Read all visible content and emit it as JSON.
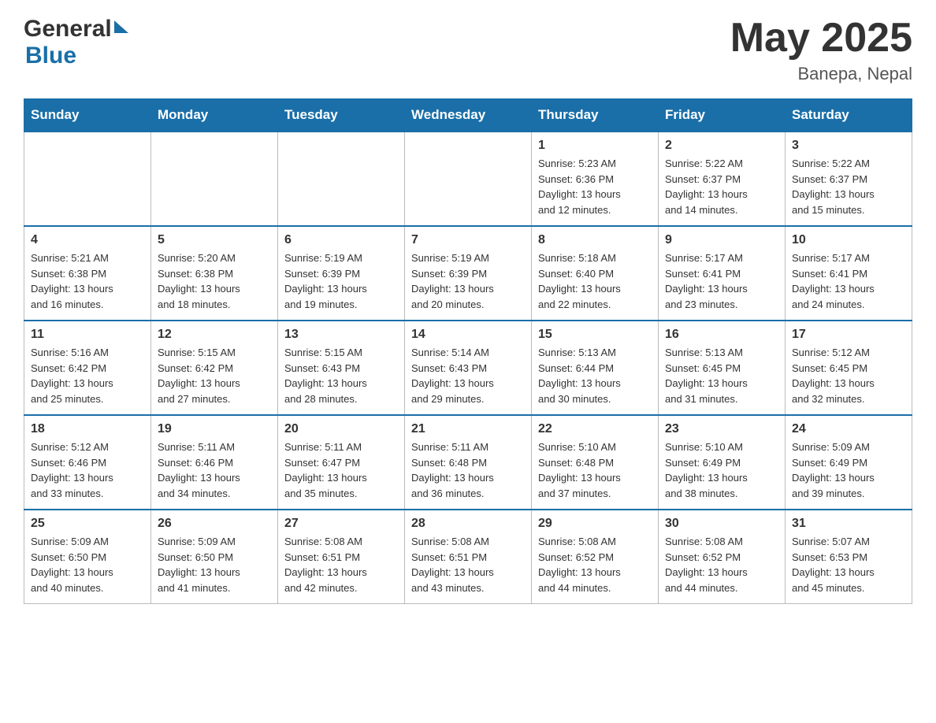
{
  "header": {
    "title": "May 2025",
    "location": "Banepa, Nepal"
  },
  "days_of_week": [
    "Sunday",
    "Monday",
    "Tuesday",
    "Wednesday",
    "Thursday",
    "Friday",
    "Saturday"
  ],
  "weeks": [
    [
      {
        "day": "",
        "info": ""
      },
      {
        "day": "",
        "info": ""
      },
      {
        "day": "",
        "info": ""
      },
      {
        "day": "",
        "info": ""
      },
      {
        "day": "1",
        "info": "Sunrise: 5:23 AM\nSunset: 6:36 PM\nDaylight: 13 hours\nand 12 minutes."
      },
      {
        "day": "2",
        "info": "Sunrise: 5:22 AM\nSunset: 6:37 PM\nDaylight: 13 hours\nand 14 minutes."
      },
      {
        "day": "3",
        "info": "Sunrise: 5:22 AM\nSunset: 6:37 PM\nDaylight: 13 hours\nand 15 minutes."
      }
    ],
    [
      {
        "day": "4",
        "info": "Sunrise: 5:21 AM\nSunset: 6:38 PM\nDaylight: 13 hours\nand 16 minutes."
      },
      {
        "day": "5",
        "info": "Sunrise: 5:20 AM\nSunset: 6:38 PM\nDaylight: 13 hours\nand 18 minutes."
      },
      {
        "day": "6",
        "info": "Sunrise: 5:19 AM\nSunset: 6:39 PM\nDaylight: 13 hours\nand 19 minutes."
      },
      {
        "day": "7",
        "info": "Sunrise: 5:19 AM\nSunset: 6:39 PM\nDaylight: 13 hours\nand 20 minutes."
      },
      {
        "day": "8",
        "info": "Sunrise: 5:18 AM\nSunset: 6:40 PM\nDaylight: 13 hours\nand 22 minutes."
      },
      {
        "day": "9",
        "info": "Sunrise: 5:17 AM\nSunset: 6:41 PM\nDaylight: 13 hours\nand 23 minutes."
      },
      {
        "day": "10",
        "info": "Sunrise: 5:17 AM\nSunset: 6:41 PM\nDaylight: 13 hours\nand 24 minutes."
      }
    ],
    [
      {
        "day": "11",
        "info": "Sunrise: 5:16 AM\nSunset: 6:42 PM\nDaylight: 13 hours\nand 25 minutes."
      },
      {
        "day": "12",
        "info": "Sunrise: 5:15 AM\nSunset: 6:42 PM\nDaylight: 13 hours\nand 27 minutes."
      },
      {
        "day": "13",
        "info": "Sunrise: 5:15 AM\nSunset: 6:43 PM\nDaylight: 13 hours\nand 28 minutes."
      },
      {
        "day": "14",
        "info": "Sunrise: 5:14 AM\nSunset: 6:43 PM\nDaylight: 13 hours\nand 29 minutes."
      },
      {
        "day": "15",
        "info": "Sunrise: 5:13 AM\nSunset: 6:44 PM\nDaylight: 13 hours\nand 30 minutes."
      },
      {
        "day": "16",
        "info": "Sunrise: 5:13 AM\nSunset: 6:45 PM\nDaylight: 13 hours\nand 31 minutes."
      },
      {
        "day": "17",
        "info": "Sunrise: 5:12 AM\nSunset: 6:45 PM\nDaylight: 13 hours\nand 32 minutes."
      }
    ],
    [
      {
        "day": "18",
        "info": "Sunrise: 5:12 AM\nSunset: 6:46 PM\nDaylight: 13 hours\nand 33 minutes."
      },
      {
        "day": "19",
        "info": "Sunrise: 5:11 AM\nSunset: 6:46 PM\nDaylight: 13 hours\nand 34 minutes."
      },
      {
        "day": "20",
        "info": "Sunrise: 5:11 AM\nSunset: 6:47 PM\nDaylight: 13 hours\nand 35 minutes."
      },
      {
        "day": "21",
        "info": "Sunrise: 5:11 AM\nSunset: 6:48 PM\nDaylight: 13 hours\nand 36 minutes."
      },
      {
        "day": "22",
        "info": "Sunrise: 5:10 AM\nSunset: 6:48 PM\nDaylight: 13 hours\nand 37 minutes."
      },
      {
        "day": "23",
        "info": "Sunrise: 5:10 AM\nSunset: 6:49 PM\nDaylight: 13 hours\nand 38 minutes."
      },
      {
        "day": "24",
        "info": "Sunrise: 5:09 AM\nSunset: 6:49 PM\nDaylight: 13 hours\nand 39 minutes."
      }
    ],
    [
      {
        "day": "25",
        "info": "Sunrise: 5:09 AM\nSunset: 6:50 PM\nDaylight: 13 hours\nand 40 minutes."
      },
      {
        "day": "26",
        "info": "Sunrise: 5:09 AM\nSunset: 6:50 PM\nDaylight: 13 hours\nand 41 minutes."
      },
      {
        "day": "27",
        "info": "Sunrise: 5:08 AM\nSunset: 6:51 PM\nDaylight: 13 hours\nand 42 minutes."
      },
      {
        "day": "28",
        "info": "Sunrise: 5:08 AM\nSunset: 6:51 PM\nDaylight: 13 hours\nand 43 minutes."
      },
      {
        "day": "29",
        "info": "Sunrise: 5:08 AM\nSunset: 6:52 PM\nDaylight: 13 hours\nand 44 minutes."
      },
      {
        "day": "30",
        "info": "Sunrise: 5:08 AM\nSunset: 6:52 PM\nDaylight: 13 hours\nand 44 minutes."
      },
      {
        "day": "31",
        "info": "Sunrise: 5:07 AM\nSunset: 6:53 PM\nDaylight: 13 hours\nand 45 minutes."
      }
    ]
  ]
}
